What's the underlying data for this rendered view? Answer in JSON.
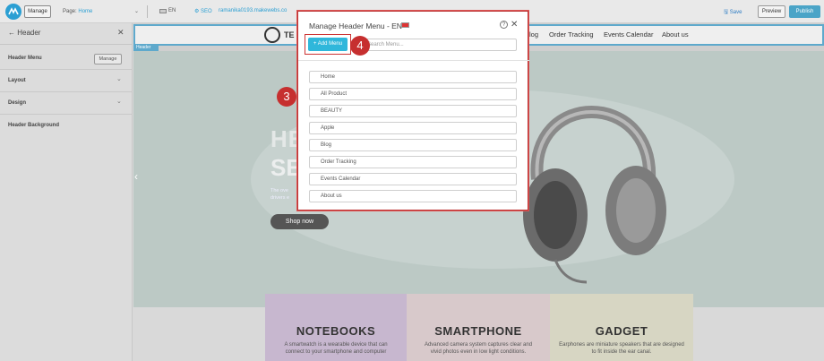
{
  "topbar": {
    "manage_label": "Manage",
    "page_prefix": "Page:",
    "page_name": "Home",
    "lang": "EN",
    "seo": "SEO",
    "site_url": "ramanika0193.makewebs.co",
    "save_label": "Save",
    "preview_label": "Preview",
    "publish_label": "Publish"
  },
  "leftpanel": {
    "back_title": "← Header",
    "rows": [
      {
        "label": "Header Menu",
        "action": "Manage"
      },
      {
        "label": "Layout"
      },
      {
        "label": "Design"
      },
      {
        "label": "Header Background"
      }
    ]
  },
  "site": {
    "header_tag": "Header",
    "logo_text": "TE",
    "nav": [
      "log",
      "Order Tracking",
      "Events Calendar",
      "About us"
    ],
    "hero_title_1": "HE",
    "hero_title_2": "SE",
    "hero_sub_1": "The ove",
    "hero_sub_2": "drivers e",
    "shop_now": "Shop now",
    "cards": [
      {
        "title": "NOTEBOOKS",
        "text_1": "A smartwatch is a wearable device that can",
        "text_2": "connect to your smartphone and computer",
        "color": "#c7b7cf"
      },
      {
        "title": "SMARTPHONE",
        "text_1": "Advanced camera system captures clear and",
        "text_2": "vivid photos even in low light conditions.",
        "color": "#d8c9cb"
      },
      {
        "title": "GADGET",
        "text_1": "Earphones are miniature speakers that are designed",
        "text_2": "to fit inside the ear canal.",
        "color": "#d7d6c3"
      }
    ]
  },
  "modal": {
    "title": "Manage Header Menu - EN",
    "add_button": "+ Add Menu",
    "search_placeholder": "Search Menu...",
    "items": [
      "Home",
      "All Product",
      "BEAUTY",
      "Apple",
      "Blog",
      "Order Tracking",
      "Events Calendar",
      "About us"
    ]
  },
  "annotations": {
    "step3": "3",
    "step4": "4"
  },
  "colors": {
    "accent": "#2fb7db",
    "annotation": "#c62f2f",
    "highlight": "#5ea9cc"
  }
}
